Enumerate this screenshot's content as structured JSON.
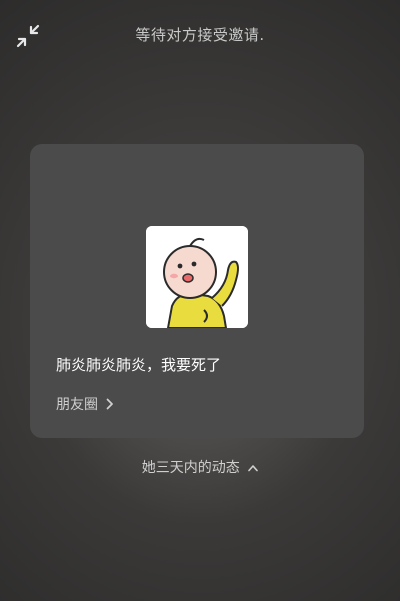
{
  "header": {
    "status_text": "等待对方接受邀请."
  },
  "card": {
    "post_text": "肺炎肺炎肺炎，我要死了",
    "moments_label": "朋友圈"
  },
  "footer": {
    "recent_label": "她三天内的动态"
  },
  "icons": {
    "minimize": "minimize-arrows-icon",
    "moments_chevron": "chevron-right-icon",
    "recent_chevron": "chevron-up-icon"
  },
  "colors": {
    "background": "#3a3939",
    "card": "#4b4b4b",
    "text_primary": "#ffffff",
    "text_secondary": "#cfcfcf"
  }
}
